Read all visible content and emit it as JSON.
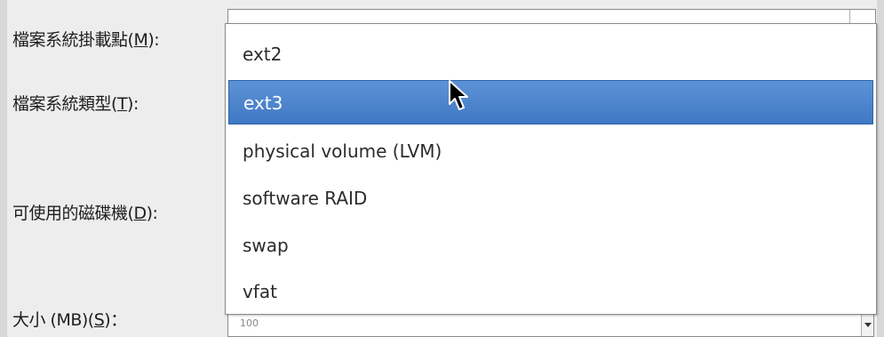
{
  "labels": {
    "mount_point": {
      "text": "檔案系統掛載點",
      "mnemonic": "M",
      "suffix": "):"
    },
    "fs_type": {
      "text": "檔案系統類型",
      "mnemonic": "T",
      "suffix": "):"
    },
    "drives": {
      "text": "可使用的磁碟機",
      "mnemonic": "D",
      "suffix": "):"
    },
    "size": {
      "text": "大小 (MB)",
      "mnemonic": "S",
      "suffix": ")："
    }
  },
  "dropdown": {
    "options": [
      "ext2",
      "ext3",
      "physical volume (LVM)",
      "software RAID",
      "swap",
      "vfat"
    ],
    "selected_option": "ext3"
  },
  "size_field": {
    "value": "100"
  },
  "colors": {
    "selection_bg": "#4a82cc",
    "selection_text": "#ffffff",
    "window_bg": "#ededed"
  }
}
